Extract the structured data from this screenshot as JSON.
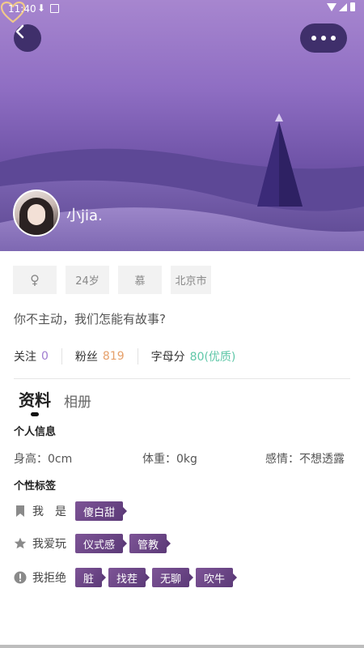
{
  "status_bar": {
    "time": "11:40",
    "icons": [
      "download-icon",
      "notification-icon",
      "wifi-icon",
      "signal-icon",
      "battery-icon"
    ]
  },
  "profile": {
    "username": "小jia.",
    "gender_symbol": "♀",
    "age": "24岁",
    "zodiac": "慕",
    "city": "北京市",
    "bio": "你不主动，我们怎能有故事?"
  },
  "stats": {
    "follow_label": "关注",
    "follow_value": "0",
    "fans_label": "粉丝",
    "fans_value": "819",
    "score_label": "字母分",
    "score_value": "80(优质)"
  },
  "tabs": {
    "profile": "资料",
    "album": "相册"
  },
  "personal_info": {
    "title": "个人信息",
    "height": "身高：0cm",
    "weight": "体重：0kg",
    "relationship": "感情：不想透露"
  },
  "personal_tags": {
    "title": "个性标签",
    "rows": [
      {
        "label": "我　是",
        "icon": "bookmark-icon",
        "tags": [
          "傻白甜"
        ]
      },
      {
        "label": "我爱玩",
        "icon": "star-icon",
        "tags": [
          "仪式感",
          "管教"
        ]
      },
      {
        "label": "我拒绝",
        "icon": "alert-icon",
        "tags": [
          "脏",
          "找茬",
          "无聊",
          "吹牛"
        ]
      }
    ]
  },
  "colors": {
    "accent_purple": "#a07cd0",
    "fans_orange": "#e6a06a",
    "score_green": "#5fc7a8",
    "tag_purple": "#6b4587",
    "banner_top": "#a786cf"
  }
}
